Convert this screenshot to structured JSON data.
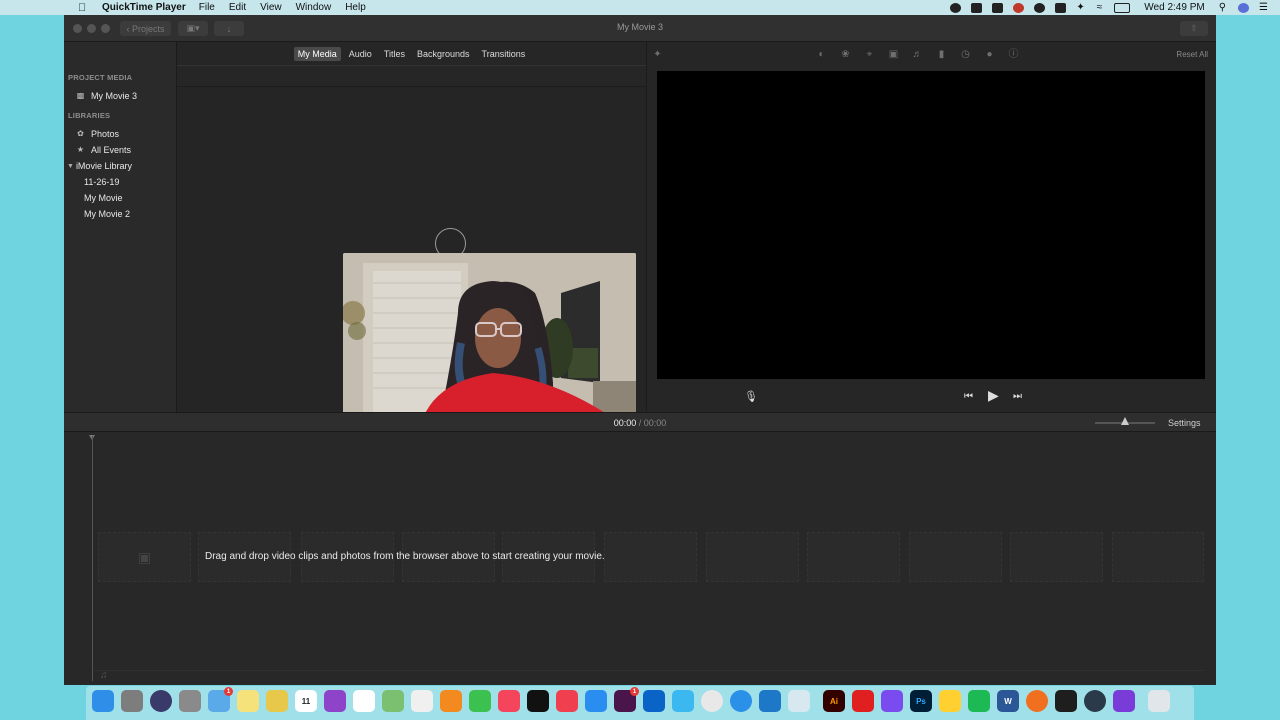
{
  "menubar": {
    "app_name": "QuickTime Player",
    "menus": [
      "File",
      "Edit",
      "View",
      "Window",
      "Help"
    ],
    "clock": "Wed 2:49 PM"
  },
  "window": {
    "title": "My Movie 3",
    "projects_button": "Projects"
  },
  "sidebar": {
    "project_media_header": "PROJECT MEDIA",
    "project_item": "My Movie 3",
    "libraries_header": "LIBRARIES",
    "items": [
      "Photos",
      "All Events",
      "iMovie Library",
      "11-26-19",
      "My Movie",
      "My Movie 2"
    ]
  },
  "browser": {
    "tabs": [
      "My Media",
      "Audio",
      "Titles",
      "Backgrounds",
      "Transitions"
    ],
    "active_tab": "My Media"
  },
  "viewer": {
    "reset_all": "Reset All"
  },
  "timeline": {
    "current_time": "00:00",
    "separator": "/",
    "total_time": "00:00",
    "settings": "Settings",
    "drop_hint": "Drag and drop video clips and photos from the browser above to start creating your movie.",
    "zoom_level": 0.5
  },
  "dock": {
    "icons": [
      "finder-icon",
      "system-preferences-icon",
      "siri-icon",
      "launchpad-icon",
      "mail-icon",
      "notes-icon",
      "stickies-icon",
      "calendar-icon",
      "podcasts-icon",
      "reminders-icon",
      "maps-icon",
      "photos-icon",
      "books-icon",
      "facetime-icon",
      "music-icon",
      "apple-tv-icon",
      "news-icon",
      "app-store-icon",
      "slack-icon",
      "outlook-icon",
      "messages-icon",
      "chrome-icon",
      "safari-icon",
      "vscode-icon",
      "preview-icon",
      "illustrator-icon",
      "acrobat-icon",
      "messenger-icon",
      "photoshop-icon",
      "miro-icon",
      "spotify-icon",
      "word-icon",
      "firefox-icon",
      "figma-icon",
      "quicktime-icon",
      "imovie-icon",
      "trash-icon"
    ],
    "calendar_day": "11",
    "illustrator_label": "Ai",
    "photoshop_label": "Ps",
    "word_label": "W",
    "mail_badge": "1",
    "slack_badge": "1"
  }
}
